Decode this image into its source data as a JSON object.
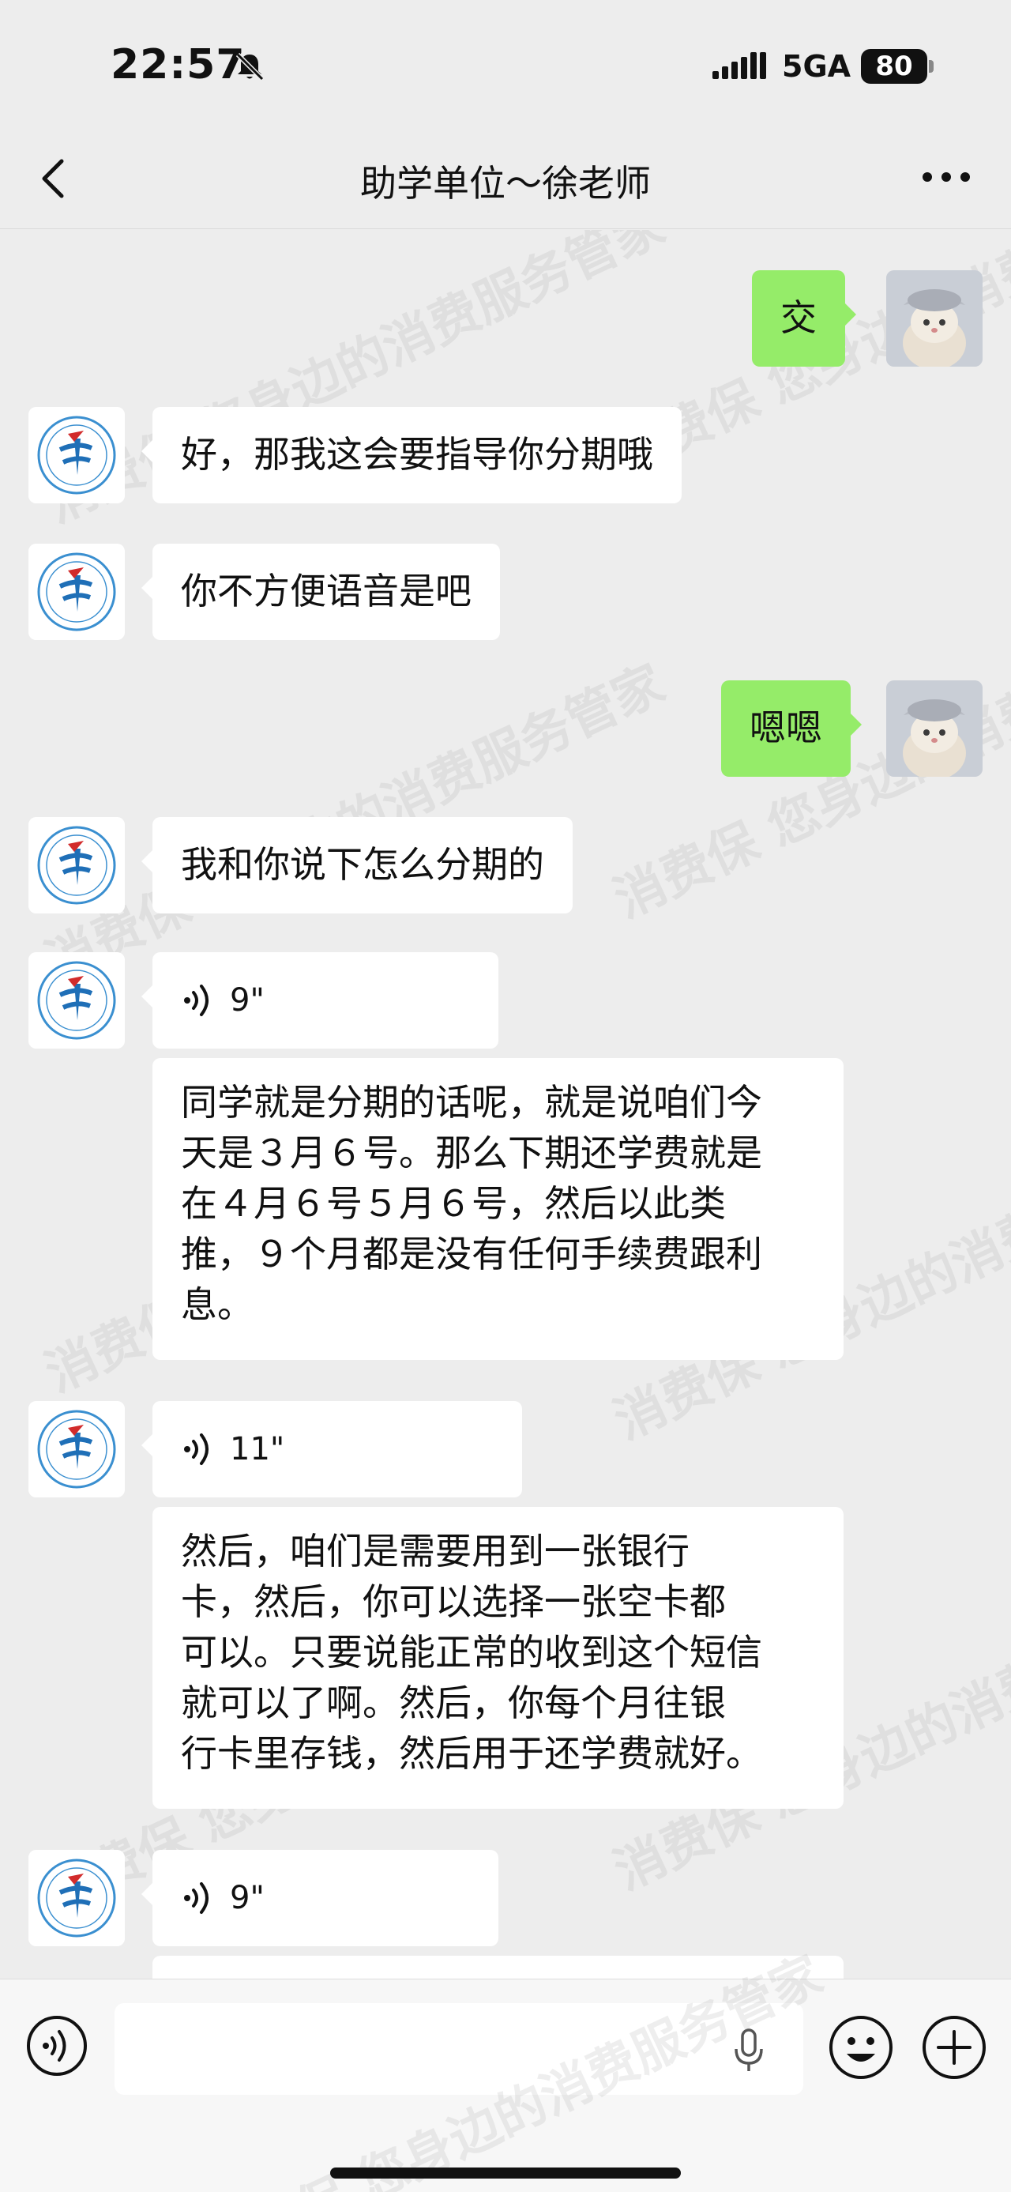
{
  "status_bar": {
    "time": "22:57",
    "network": "5GA",
    "battery": "80"
  },
  "header": {
    "title": "助学单位～徐老师"
  },
  "watermark": {
    "text": "消费保 您身边的消费服务管家"
  },
  "messages": [
    {
      "side": "out",
      "type": "text",
      "text": "交"
    },
    {
      "side": "in",
      "type": "text",
      "text": "好，那我这会要指导你分期哦"
    },
    {
      "side": "in",
      "type": "text",
      "text": "你不方便语音是吧"
    },
    {
      "side": "out",
      "type": "text",
      "text": "嗯嗯"
    },
    {
      "side": "in",
      "type": "text",
      "text": "我和你说下怎么分期的"
    },
    {
      "side": "in",
      "type": "voice",
      "duration": "9\""
    },
    {
      "side": "in",
      "type": "transcript",
      "lines": [
        "同学就是分期的话呢，就是说咱们今",
        "天是３月６号。那么下期还学费就是",
        "在４月６号５月６号，然后以此类",
        "推，９个月都是没有任何手续费跟利",
        "息。"
      ]
    },
    {
      "side": "in",
      "type": "voice",
      "duration": "11\""
    },
    {
      "side": "in",
      "type": "transcript",
      "lines": [
        "然后，咱们是需要用到一张银行",
        "卡，然后，你可以选择一张空卡都",
        "可以。只要说能正常的收到这个短信",
        "就可以了啊。然后，你每个月往银",
        "行卡里存钱，然后用于还学费就好。"
      ]
    },
    {
      "side": "in",
      "type": "voice",
      "duration": "9\""
    }
  ],
  "colors": {
    "background": "#ededed",
    "bubble_out": "#95ec69",
    "bubble_in": "#ffffff"
  },
  "icons": [
    "bell-muted-icon",
    "signal-icon",
    "back-icon",
    "more-icon",
    "voice-toggle-icon",
    "microphone-icon",
    "emoji-icon",
    "plus-icon"
  ]
}
